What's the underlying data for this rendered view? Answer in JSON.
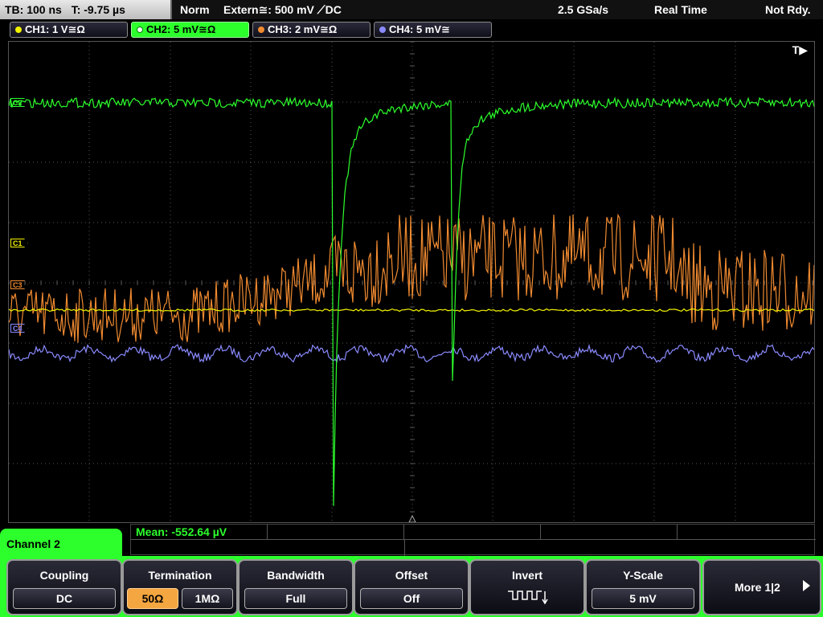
{
  "status": {
    "timebase": "TB: 100 ns",
    "trigger_time": "T: -9.75 µs",
    "mode": "Norm",
    "trigger": "Extern≅: 500 mV ⟋DC",
    "sample_rate": "2.5 GSa/s",
    "acq_mode": "Real Time",
    "ready": "Not Rdy."
  },
  "channels": [
    {
      "label": "CH1: 1 V≅Ω",
      "color": "#f2f200"
    },
    {
      "label": "CH2: 5 mV≅Ω",
      "color": "#2cff2c",
      "active": true
    },
    {
      "label": "CH3: 2 mV≅Ω",
      "color": "#f08a30"
    },
    {
      "label": "CH4: 5 mV≅",
      "color": "#8a8aff"
    }
  ],
  "markers": {
    "trigger": "T▶",
    "c2": "C2",
    "c1": "C1",
    "c3": "C3",
    "c4": "C4"
  },
  "measurement": {
    "mean": "Mean: -552.64 µV"
  },
  "menu": {
    "title": "Channel 2",
    "coupling": {
      "title": "Coupling",
      "value": "DC"
    },
    "termination": {
      "title": "Termination",
      "options": [
        "50Ω",
        "1MΩ"
      ],
      "selected": "50Ω"
    },
    "bandwidth": {
      "title": "Bandwidth",
      "value": "Full"
    },
    "offset": {
      "title": "Offset",
      "value": "Off"
    },
    "invert": {
      "title": "Invert"
    },
    "yscale": {
      "title": "Y-Scale",
      "value": "5 mV"
    },
    "more": "More 1|2"
  },
  "colors": {
    "accent": "#2cff2c",
    "ch1": "#f2f200",
    "ch2": "#2cff2c",
    "ch3": "#f08a30",
    "ch4": "#8a8aff"
  }
}
